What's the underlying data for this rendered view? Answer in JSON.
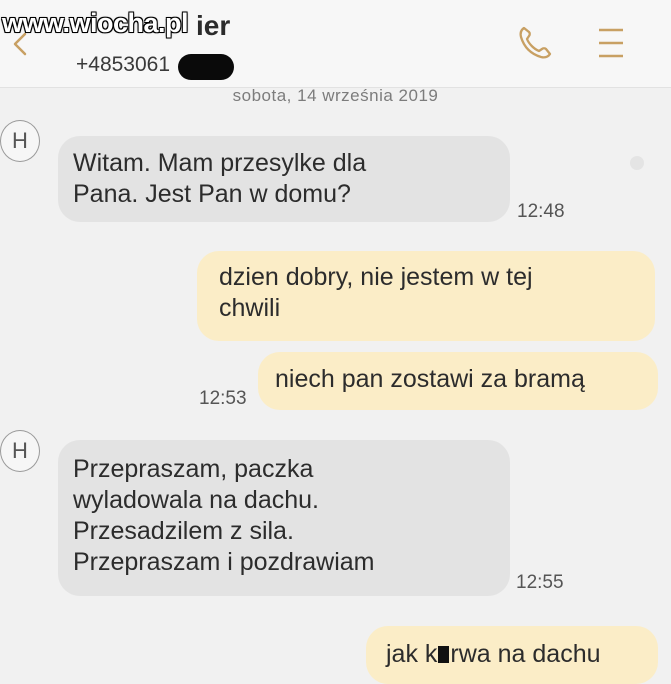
{
  "header": {
    "watermark": "www.wiocha.pl",
    "contact_name": "ier",
    "contact_number": "+4853061"
  },
  "date_separator": "sobota, 14 września 2019",
  "avatar_letter": "H",
  "messages": [
    {
      "direction": "incoming",
      "lines": [
        "Witam. Mam przesylke dla",
        "Pana. Jest Pan w domu?"
      ],
      "time": "12:48"
    },
    {
      "direction": "outgoing",
      "lines": [
        "dzien dobry, nie jestem w tej",
        "chwili"
      ]
    },
    {
      "direction": "outgoing",
      "lines": [
        "niech pan zostawi za bramą"
      ],
      "time": "12:53"
    },
    {
      "direction": "incoming",
      "lines": [
        "Przepraszam, paczka",
        "wyladowala na dachu.",
        "Przesadzilem z sila.",
        "Przepraszam i pozdrawiam"
      ],
      "time": "12:55"
    },
    {
      "direction": "outgoing",
      "text_before": "jak k",
      "text_after": "rwa na dachu"
    }
  ],
  "icons": {
    "back": "chevron-left-icon",
    "call": "phone-icon",
    "menu": "menu-icon"
  },
  "colors": {
    "incoming_bubble": "#e3e3e3",
    "outgoing_bubble": "#fbedc7",
    "accent": "#c8a063"
  }
}
